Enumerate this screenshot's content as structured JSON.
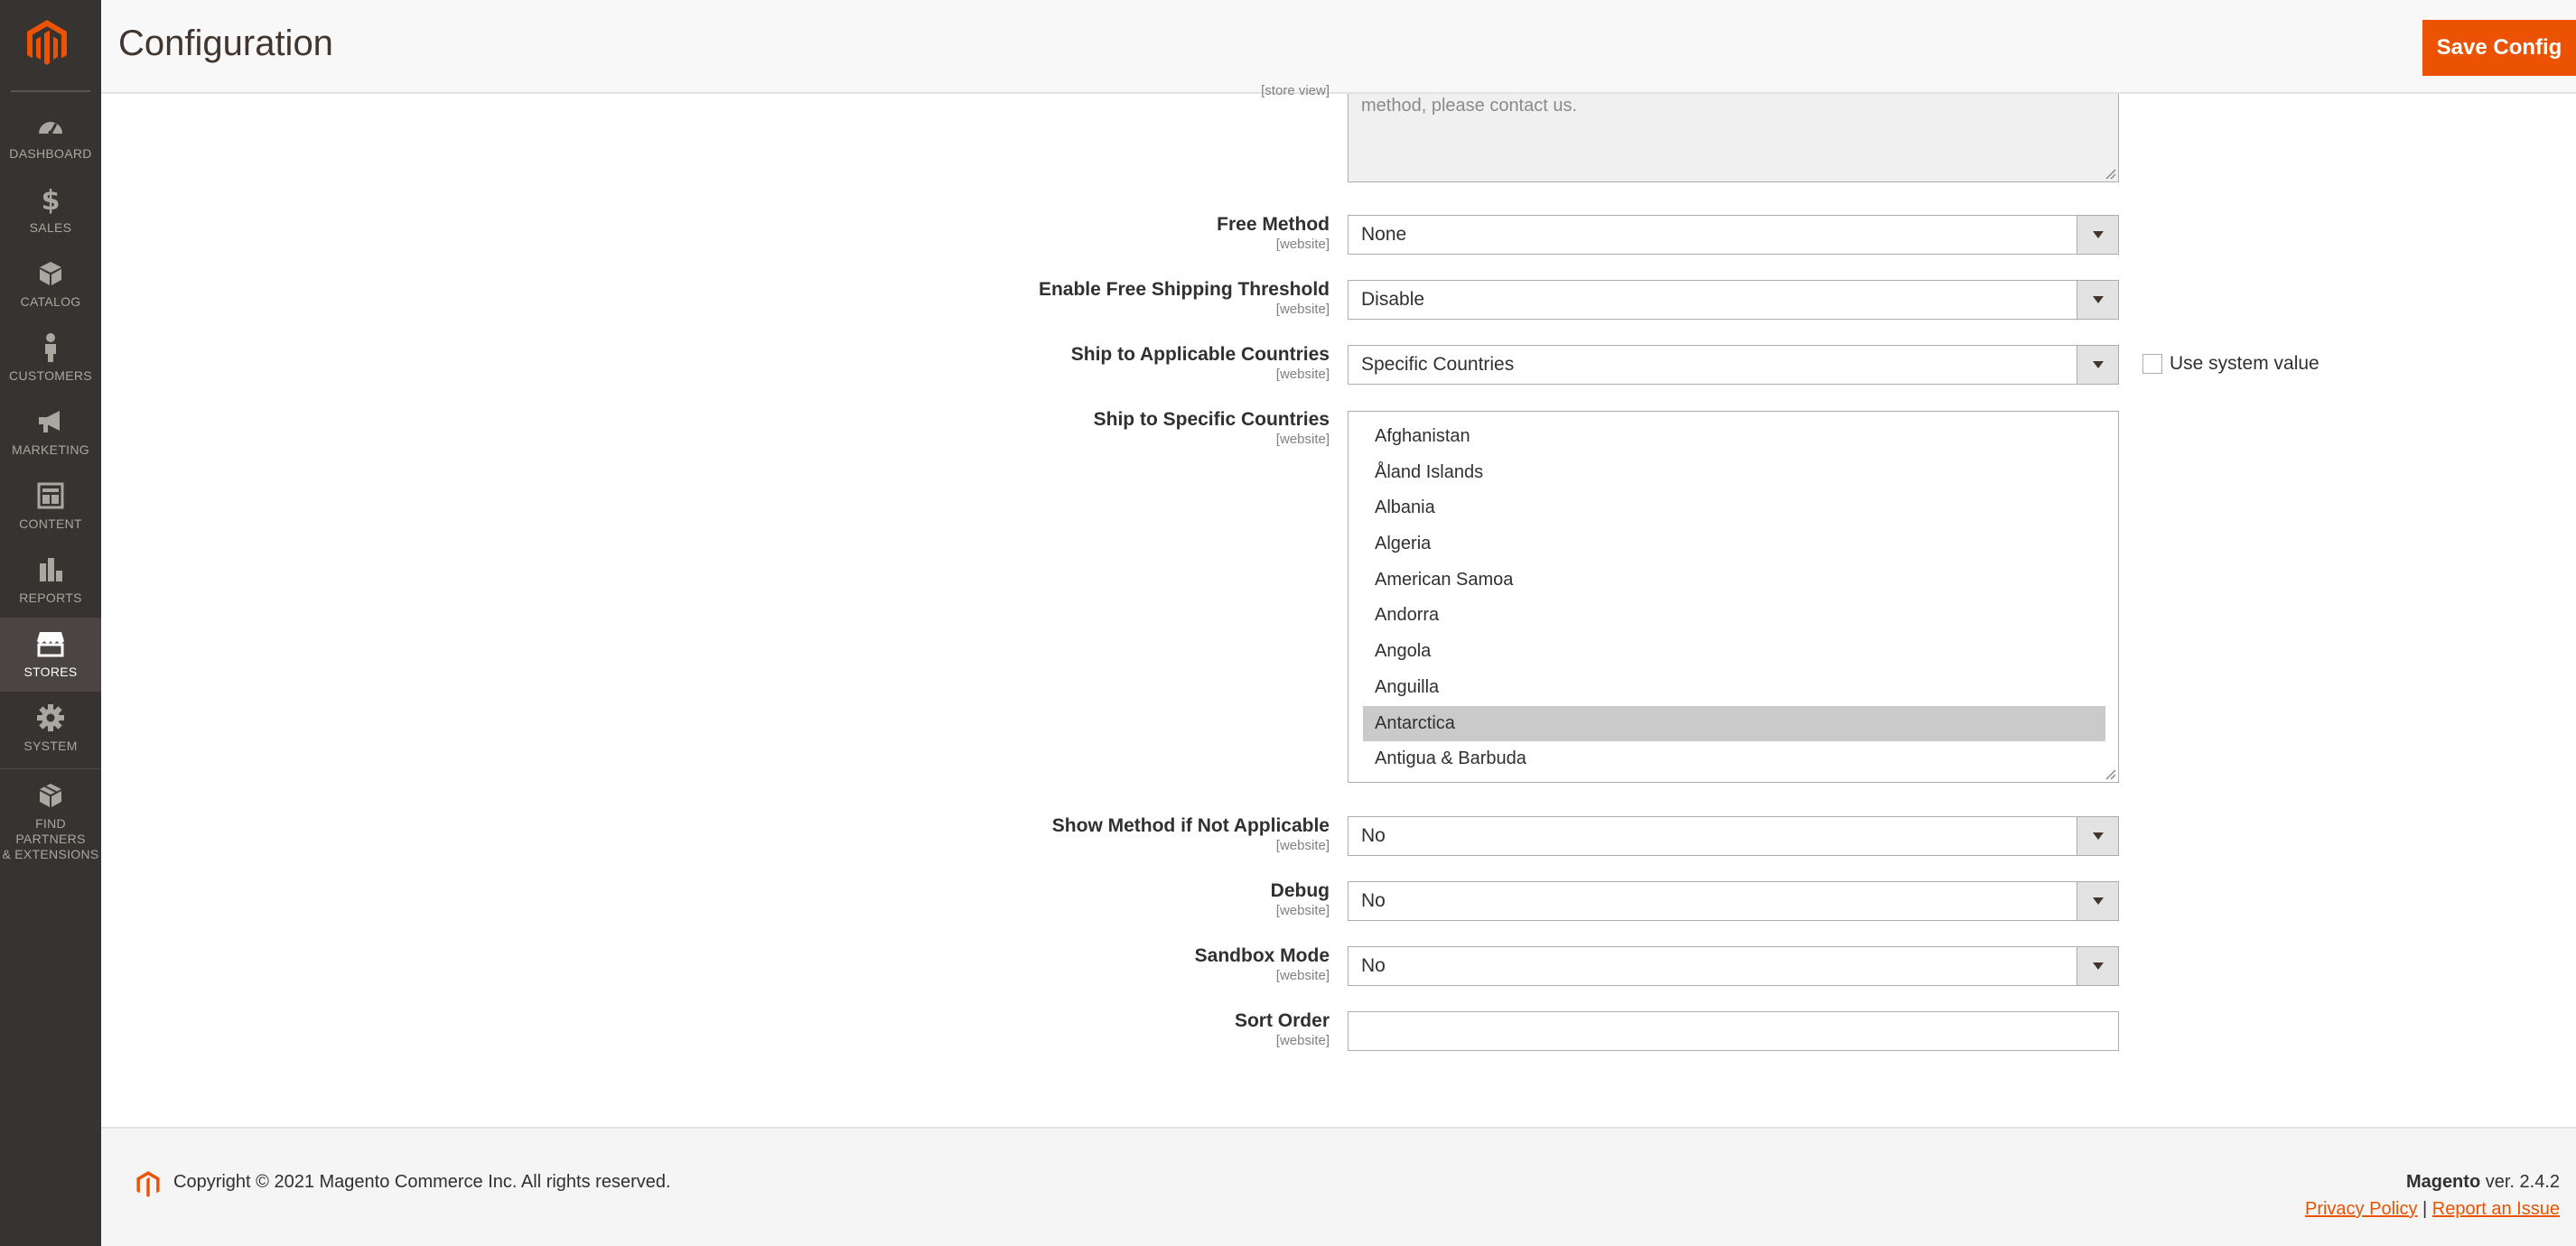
{
  "sidebar": {
    "items": [
      {
        "label": "DASHBOARD",
        "icon": "dashboard-icon",
        "active": false
      },
      {
        "label": "SALES",
        "icon": "dollar-icon",
        "active": false
      },
      {
        "label": "CATALOG",
        "icon": "cube-icon",
        "active": false
      },
      {
        "label": "CUSTOMERS",
        "icon": "person-icon",
        "active": false
      },
      {
        "label": "MARKETING",
        "icon": "megaphone-icon",
        "active": false
      },
      {
        "label": "CONTENT",
        "icon": "layout-icon",
        "active": false
      },
      {
        "label": "REPORTS",
        "icon": "bar-chart-icon",
        "active": false
      },
      {
        "label": "STORES",
        "icon": "storefront-icon",
        "active": true
      },
      {
        "label": "SYSTEM",
        "icon": "gear-icon",
        "active": false
      },
      {
        "label": "FIND PARTNERS & EXTENSIONS",
        "label_line1": "FIND PARTNERS",
        "label_line2": "& EXTENSIONS",
        "icon": "boxes-icon",
        "active": false
      }
    ]
  },
  "header": {
    "title": "Configuration",
    "save_label": "Save Config"
  },
  "form": {
    "textarea_tail": {
      "scope": "[store view]",
      "text": "method, please contact us."
    },
    "free_method": {
      "label": "Free Method",
      "scope": "[website]",
      "value": "None"
    },
    "free_shipping_threshold": {
      "label": "Enable Free Shipping Threshold",
      "scope": "[website]",
      "value": "Disable"
    },
    "ship_applicable": {
      "label": "Ship to Applicable Countries",
      "scope": "[website]",
      "value": "Specific Countries",
      "use_system_label": "Use system value",
      "use_system_checked": false
    },
    "ship_specific": {
      "label": "Ship to Specific Countries",
      "scope": "[website]",
      "options": [
        "Afghanistan",
        "Åland Islands",
        "Albania",
        "Algeria",
        "American Samoa",
        "Andorra",
        "Angola",
        "Anguilla",
        "Antarctica",
        "Antigua & Barbuda"
      ],
      "selected": "Antarctica"
    },
    "show_method": {
      "label": "Show Method if Not Applicable",
      "scope": "[website]",
      "value": "No"
    },
    "debug": {
      "label": "Debug",
      "scope": "[website]",
      "value": "No"
    },
    "sandbox": {
      "label": "Sandbox Mode",
      "scope": "[website]",
      "value": "No"
    },
    "sort_order": {
      "label": "Sort Order",
      "scope": "[website]",
      "value": ""
    }
  },
  "footer": {
    "copyright": "Copyright © 2021 Magento Commerce Inc. All rights reserved.",
    "brand": "Magento",
    "version": "ver. 2.4.2",
    "privacy": "Privacy Policy",
    "separator": "|",
    "report": "Report an Issue"
  },
  "colors": {
    "accent": "#eb5202",
    "sidebar_bg": "#373330",
    "sidebar_active": "#4a4542",
    "selected_option": "#cacaca"
  }
}
